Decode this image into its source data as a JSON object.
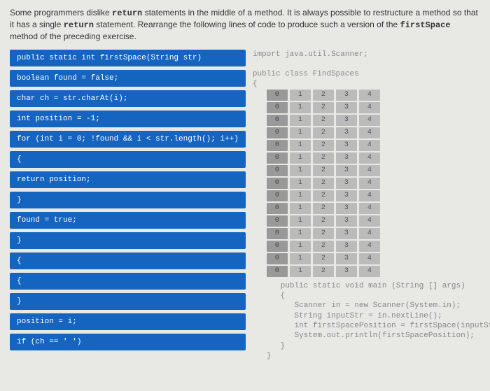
{
  "instructions": {
    "text_parts": [
      "Some programmers dislike ",
      "return",
      " statements in the middle of a method. It is always possible to restructure a method so that it has a single ",
      "return",
      " statement. Rearrange the following lines of code to produce such a version of the ",
      "firstSpace",
      " method of the preceding exercise."
    ]
  },
  "code_blocks": [
    "public static int firstSpace(String str)",
    "boolean found = false;",
    "char ch = str.charAt(i);",
    "int position = -1;",
    "for (int i = 0; !found && i < str.length(); i++)",
    "{",
    "return position;",
    "}",
    "found = true;",
    "}",
    "{",
    "{",
    "}",
    "position = i;",
    "if (ch == ' ')"
  ],
  "target_code": {
    "header": "import java.util.Scanner;\n\npublic class FindSpaces\n{",
    "main_method": "   public static void main (String [] args)\n   {\n      Scanner in = new Scanner(System.in);\n      String inputStr = in.nextLine();\n      int firstSpacePosition = firstSpace(inputStr);\n      System.out.println(firstSpacePosition);\n   }\n}"
  },
  "slot_labels": [
    "0",
    "1",
    "2",
    "3",
    "4"
  ],
  "slot_count": 15
}
